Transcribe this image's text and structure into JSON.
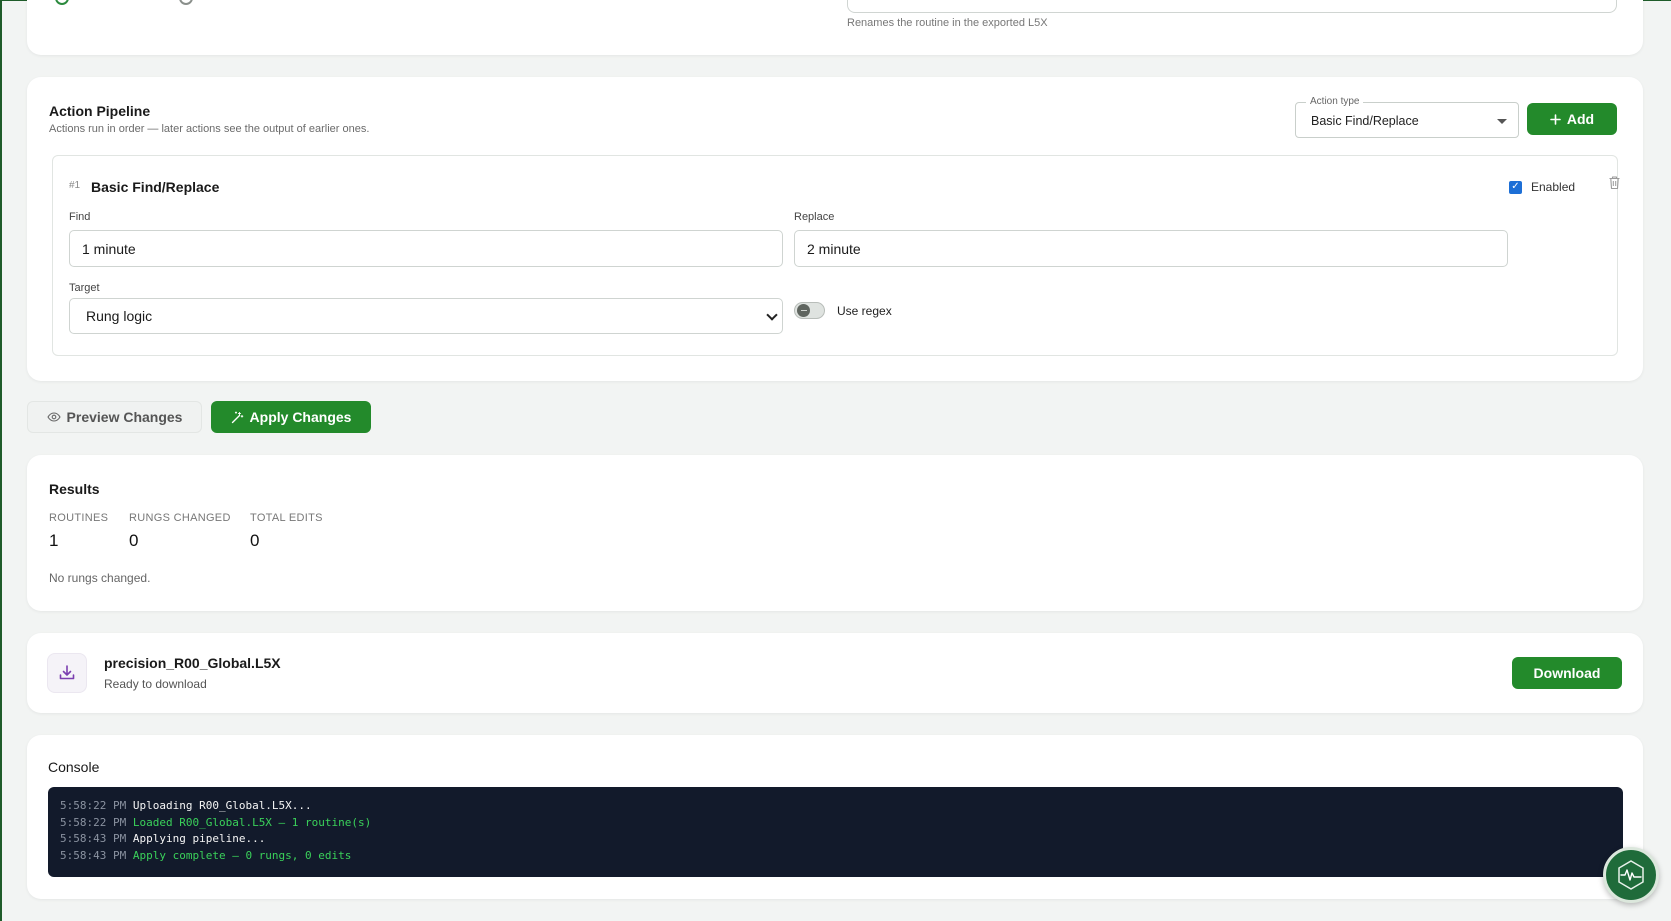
{
  "rename_section": {
    "hint": "Renames the routine in the exported L5X"
  },
  "pipeline": {
    "title": "Action Pipeline",
    "subtitle": "Actions run in order — later actions see the output of earlier ones.",
    "action_type_legend": "Action type",
    "action_type_value": "Basic Find/Replace",
    "add_label": "Add",
    "action": {
      "number": "#1",
      "title": "Basic Find/Replace",
      "enabled_label": "Enabled",
      "enabled": true,
      "find_label": "Find",
      "find_value": "1 minute",
      "replace_label": "Replace",
      "replace_value": "2 minute",
      "target_label": "Target",
      "target_value": "Rung logic",
      "regex_label": "Use regex",
      "regex_enabled": false
    }
  },
  "buttons": {
    "preview_label": "Preview Changes",
    "apply_label": "Apply Changes"
  },
  "results": {
    "title": "Results",
    "stats": [
      {
        "label": "ROUTINES",
        "value": "1"
      },
      {
        "label": "RUNGS CHANGED",
        "value": "0"
      },
      {
        "label": "TOTAL EDITS",
        "value": "0"
      }
    ],
    "message": "No rungs changed."
  },
  "download": {
    "filename": "precision_R00_Global.L5X",
    "status": "Ready to download",
    "button_label": "Download"
  },
  "console": {
    "title": "Console",
    "lines": [
      {
        "time": "5:58:22 PM",
        "message": "Uploading R00_Global.L5X...",
        "level": "info"
      },
      {
        "time": "5:58:22 PM",
        "message": "Loaded R00_Global.L5X — 1 routine(s)",
        "level": "success"
      },
      {
        "time": "5:58:43 PM",
        "message": "Applying pipeline...",
        "level": "info"
      },
      {
        "time": "5:58:43 PM",
        "message": "Apply complete — 0 rungs, 0 edits",
        "level": "success"
      }
    ]
  },
  "colors": {
    "accent_green": "#238a2b",
    "console_bg": "#121a2b",
    "console_success": "#3ad15a"
  }
}
